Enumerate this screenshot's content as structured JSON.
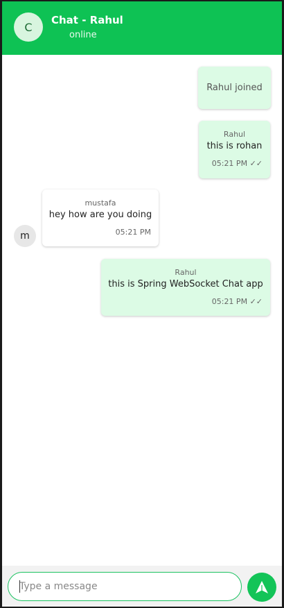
{
  "header": {
    "avatar_letter": "C",
    "title": "Chat - Rahul",
    "status": "online",
    "bg_color": "#0ec254"
  },
  "messages": [
    {
      "type": "system",
      "text": "Rahul joined"
    },
    {
      "type": "outgoing",
      "sender": "Rahul",
      "text": "this is rohan",
      "time": "05:21 PM",
      "ticks": "✓✓"
    },
    {
      "type": "incoming",
      "sender": "mustafa",
      "text": "hey how are you doing",
      "time": "05:21 PM",
      "avatar_letter": "m"
    },
    {
      "type": "outgoing",
      "sender": "Rahul",
      "text": "this is Spring WebSocket Chat app",
      "time": "05:21 PM",
      "ticks": "✓✓"
    }
  ],
  "composer": {
    "placeholder": "Type a message",
    "value": ""
  },
  "send_button": {
    "icon": "send-icon",
    "color": "#13c458"
  }
}
